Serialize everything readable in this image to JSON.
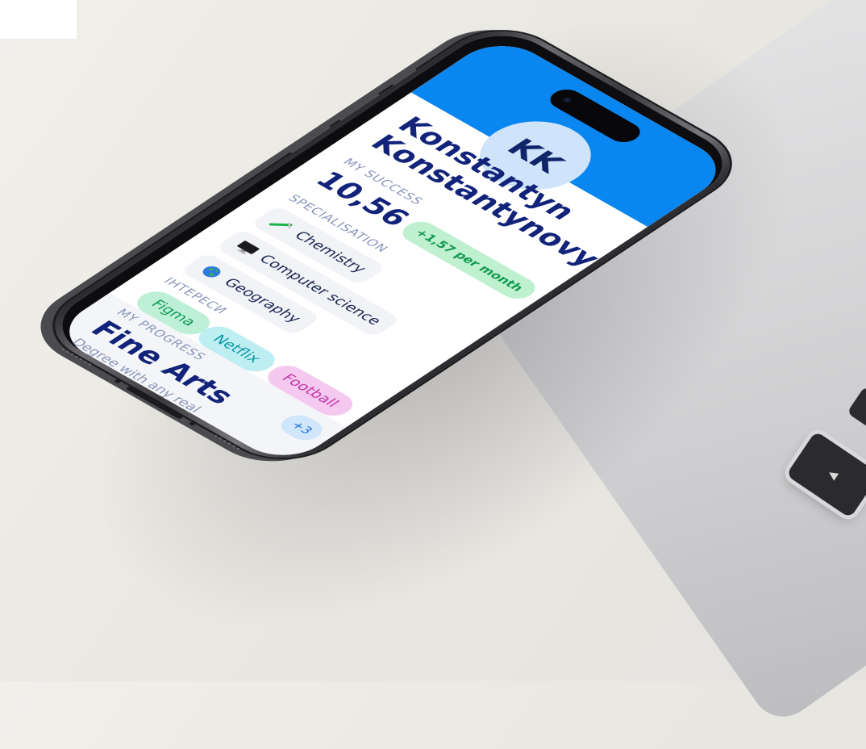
{
  "backdrop": {
    "laptop_key_label": "◀"
  },
  "profile": {
    "initials": "KK",
    "first_name": "Konstantyn",
    "last_name": "Konstantynovych"
  },
  "success": {
    "label": "MY SUCCESS",
    "value": "10,56",
    "delta": "+1,57 per month"
  },
  "specialisation": {
    "label": "SPECIALISATION",
    "items": [
      {
        "icon": "test-tube-icon",
        "label": "Chemistry"
      },
      {
        "icon": "computer-monitor-icon",
        "label": "Computer science"
      },
      {
        "icon": "globe-icon",
        "label": "Geography"
      }
    ]
  },
  "interests": {
    "label": "ІНТЕРЕСИ",
    "items": [
      {
        "label": "Figma",
        "bg": "#bdf0d6",
        "color": "#139a5a"
      },
      {
        "label": "Netflix",
        "bg": "#bdeef2",
        "color": "#0f9aa8"
      },
      {
        "label": "Football",
        "bg": "#f5c9ef",
        "color": "#c23aa8"
      }
    ],
    "more": "+3",
    "more_bg": "#cfe6fb",
    "more_color": "#1a6fd2"
  },
  "progress": {
    "label": "MY PROGRESS",
    "title": "Fine Arts",
    "subtitle": "Degree with any real indicator"
  },
  "colors": {
    "header_blue": "#0a86f0",
    "navy_text": "#12237a",
    "muted_label": "#8a96ba"
  }
}
